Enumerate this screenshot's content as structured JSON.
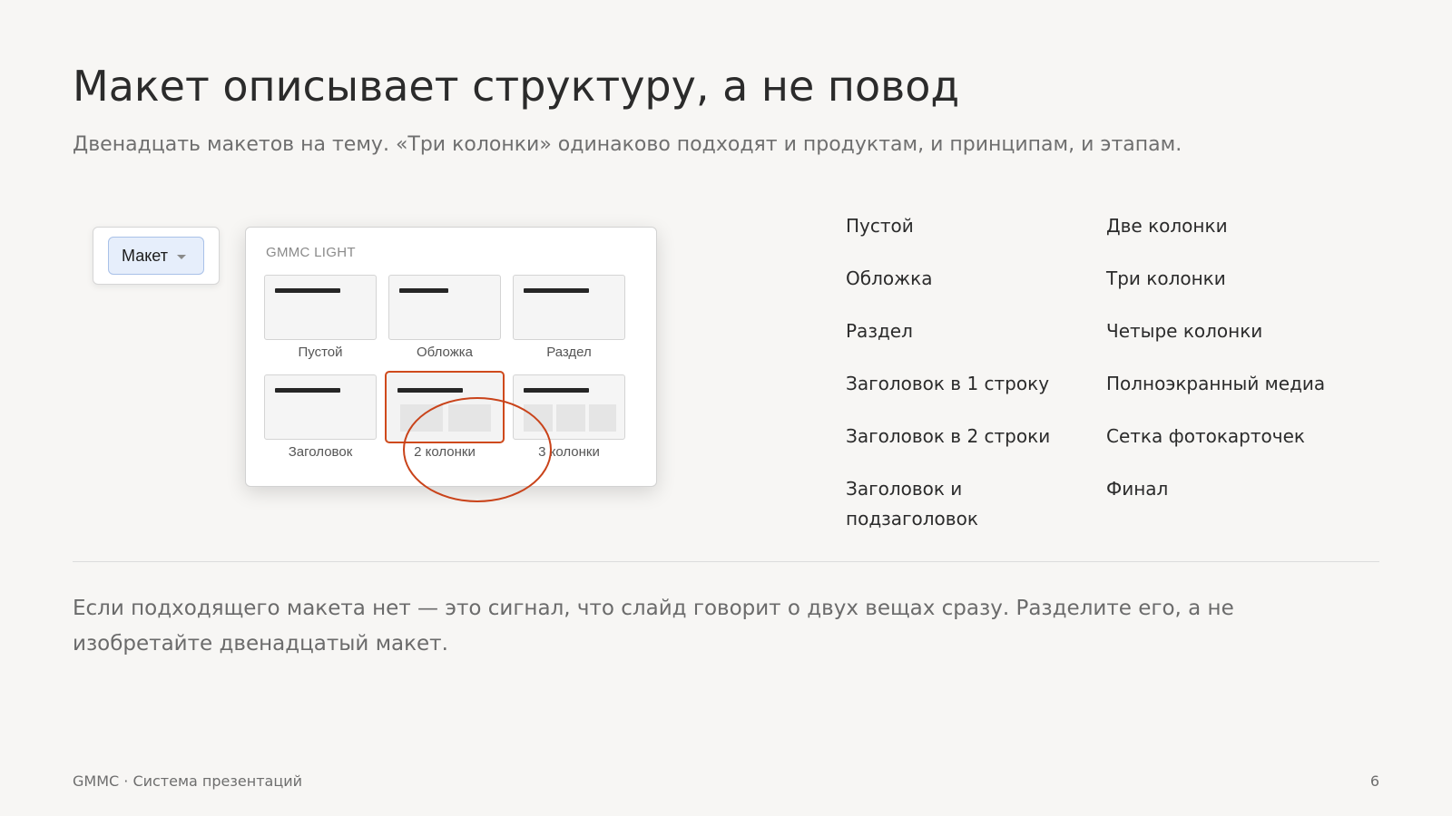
{
  "slide": {
    "title": "Макет описывает структуру, а не повод",
    "subtitle": "Двенадцать макетов на тему. «Три колонки» одинаково подходят и продуктам, и принципам, и этапам."
  },
  "dropdown": {
    "label": "Макет",
    "icon": "caret-down-icon"
  },
  "picker": {
    "header": "GMMC LIGHT",
    "thumbnails": [
      {
        "label": "Пустой",
        "columns": 0,
        "selected": false
      },
      {
        "label": "Обложка",
        "columns": 0,
        "selected": false
      },
      {
        "label": "Раздел",
        "columns": 0,
        "selected": false
      },
      {
        "label": "Заголовок",
        "columns": 0,
        "selected": false
      },
      {
        "label": "2 колонки",
        "columns": 2,
        "selected": true
      },
      {
        "label": "3 колонки",
        "columns": 3,
        "selected": false
      }
    ],
    "accent_color": "#cf4a1c"
  },
  "layouts_list": {
    "left": [
      "Пустой",
      "Обложка",
      "Раздел",
      "Заголовок в 1 строку",
      "Заголовок в 2 строки",
      "Заголовок и подзаголовок"
    ],
    "right": [
      "Две колонки",
      "Три колонки",
      "Четыре колонки",
      "Полноэкранный медиа",
      "Сетка фотокарточек",
      "Финал"
    ]
  },
  "note": "Если подходящего макета нет — это сигнал, что слайд говорит о двух вещах сразу. Разделите его, а не изобретайте двенадцатый макет.",
  "footer": {
    "left": "GMMC · Система презентаций",
    "page_number": "6"
  }
}
